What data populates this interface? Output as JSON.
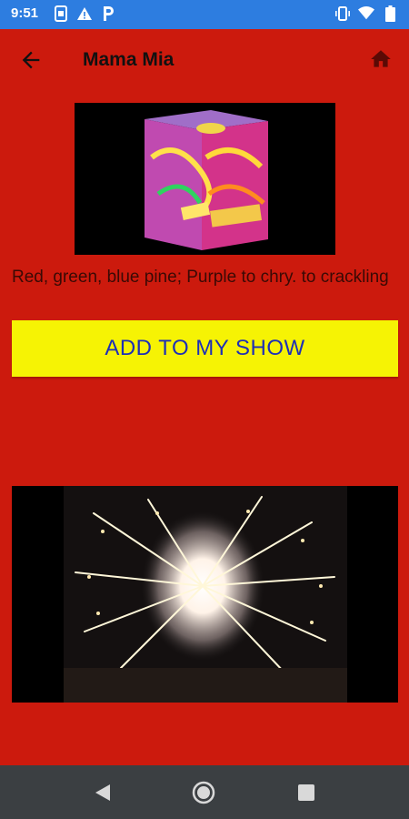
{
  "status_bar": {
    "time": "9:51",
    "left_icons": [
      "sim-icon",
      "warning-icon",
      "parking-icon"
    ],
    "right_icons": [
      "vibrate-icon",
      "wifi-icon",
      "battery-icon"
    ]
  },
  "app_bar": {
    "title": "Mama Mia",
    "back_icon": "arrow-back-icon",
    "home_icon": "home-icon"
  },
  "product": {
    "description": "Red, green, blue pine; Purple to chry. to crackling",
    "add_button_label": "ADD TO MY SHOW"
  },
  "nav_bar": {
    "icons": [
      "nav-back-icon",
      "nav-home-icon",
      "nav-recents-icon"
    ]
  },
  "colors": {
    "background": "#cc1a0d",
    "status_bar": "#2d7de0",
    "button": "#f6f304",
    "button_text": "#1e2fb6",
    "nav_bar": "#3b3f42"
  }
}
